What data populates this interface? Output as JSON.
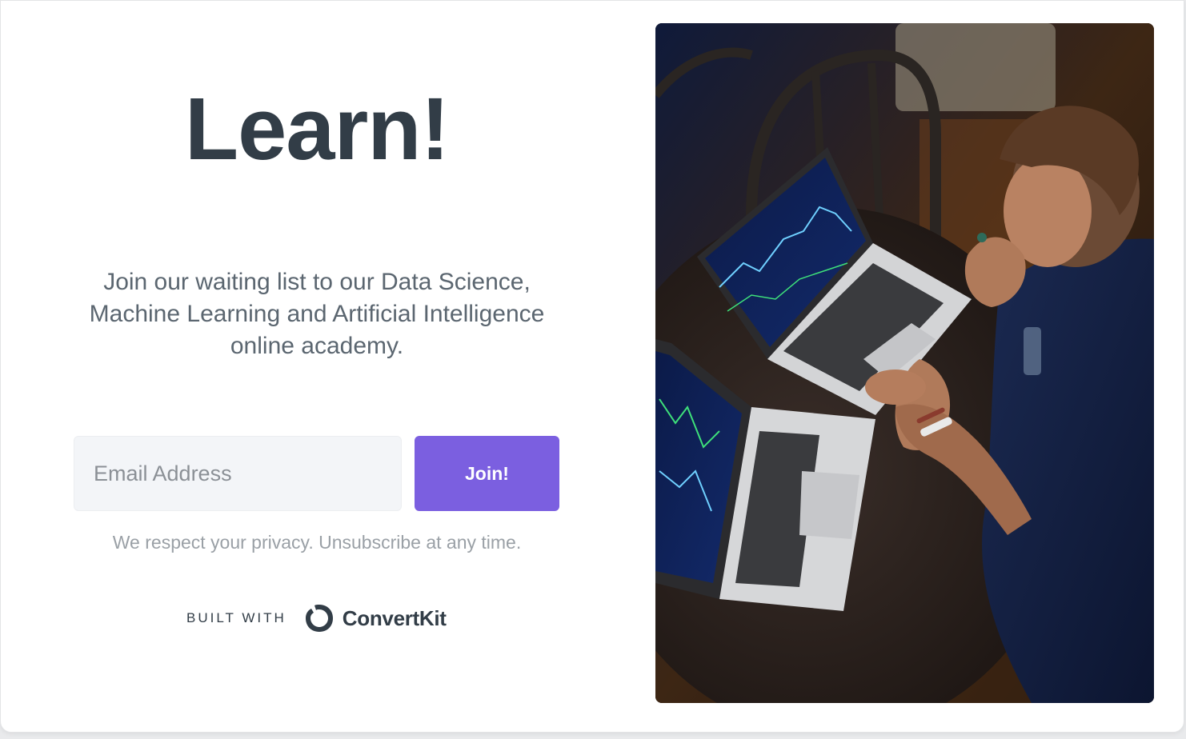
{
  "form": {
    "headline": "Learn!",
    "subtitle": "Join our waiting list to our Data Science, Machine Learning and Artificial Intelligence online academy.",
    "email_placeholder": "Email Address",
    "submit_label": "Join!",
    "privacy_note": "We respect your privacy. Unsubscribe at any time."
  },
  "branding": {
    "built_with_label": "BUILT WITH",
    "brand_name": "ConvertKit",
    "brand_icon": "convertkit-logo-icon"
  },
  "hero_image": {
    "description_icon": "photo-person-with-laptops"
  },
  "colors": {
    "accent": "#7b5fe0",
    "headline": "#323d47",
    "body_text": "#5b6670",
    "muted_text": "#9aa0a6",
    "input_bg": "#f3f5f8"
  }
}
